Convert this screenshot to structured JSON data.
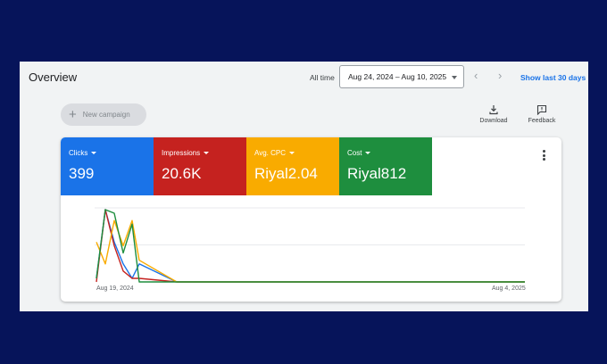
{
  "page": {
    "title": "Overview"
  },
  "toolbar": {
    "date_label": "All time",
    "date_range": "Aug 24, 2024 – Aug 10, 2025",
    "prev": "‹",
    "next": "›",
    "show_last": "Show last 30 days"
  },
  "actions": {
    "new_campaign": "New campaign",
    "new_campaign_icon": "+",
    "download": "Download",
    "feedback": "Feedback"
  },
  "metrics": [
    {
      "label": "Clicks",
      "value": "399",
      "color": "#1a73e8"
    },
    {
      "label": "Impressions",
      "value": "20.6K",
      "color": "#c5221f"
    },
    {
      "label": "Avg. CPC",
      "value": "Riyal2.04",
      "color": "#f9ab00"
    },
    {
      "label": "Cost",
      "value": "Riyal812",
      "color": "#1e8e3e"
    }
  ],
  "chart_data": {
    "type": "line",
    "x_labels": [
      "Aug 19, 2024",
      "Aug 4, 2025"
    ],
    "grid": true,
    "series": [
      {
        "color": "#1a73e8",
        "values": [
          0.05,
          1.0,
          0.55,
          0.25,
          0.05,
          0.25,
          0.0,
          0.0,
          0.0
        ]
      },
      {
        "color": "#c5221f",
        "values": [
          0.0,
          1.0,
          0.5,
          0.15,
          0.05,
          0.05,
          0.0,
          0.0,
          0.0
        ]
      },
      {
        "color": "#f9ab00",
        "values": [
          0.55,
          0.25,
          0.85,
          0.5,
          0.85,
          0.3,
          0.0,
          0.0,
          0.0
        ]
      },
      {
        "color": "#1e8e3e",
        "values": [
          0.05,
          1.0,
          0.95,
          0.4,
          0.8,
          0.0,
          0.0,
          0.0,
          0.0
        ]
      }
    ]
  }
}
